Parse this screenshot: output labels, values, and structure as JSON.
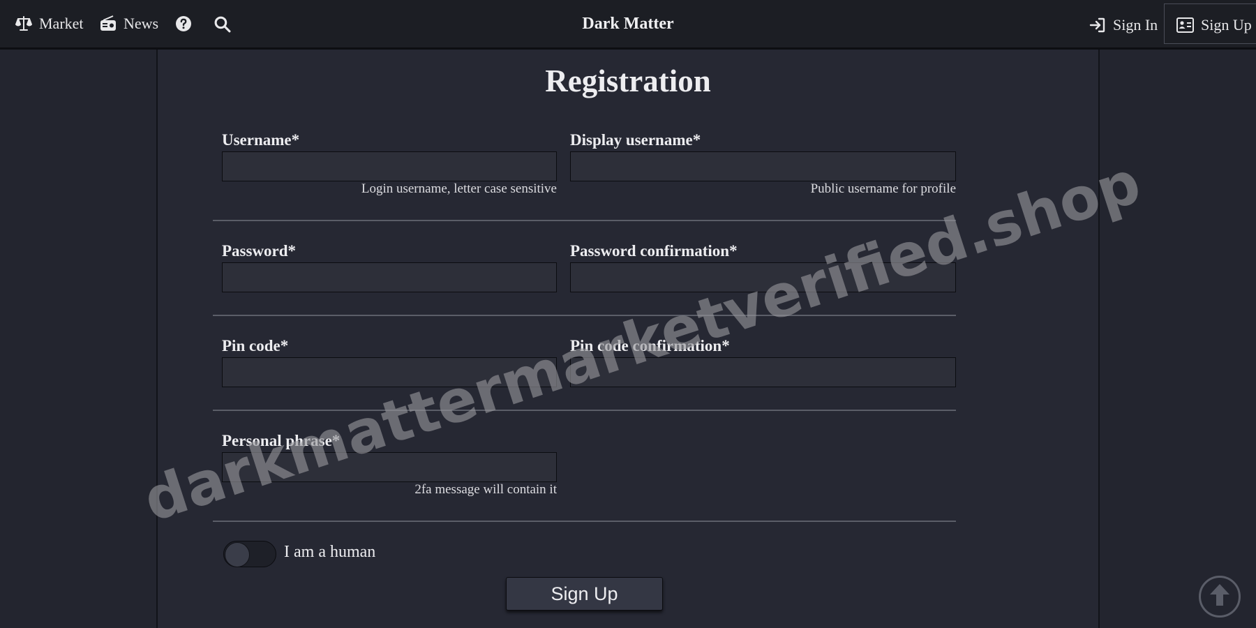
{
  "nav": {
    "market_label": "Market",
    "news_label": "News",
    "brand": "Dark Matter",
    "signin_label": "Sign In",
    "signup_label": "Sign Up"
  },
  "form": {
    "title": "Registration",
    "username": {
      "label": "Username*",
      "value": "",
      "help": "Login username, letter case sensitive"
    },
    "display_username": {
      "label": "Display username*",
      "value": "",
      "help": "Public username for profile"
    },
    "password": {
      "label": "Password*",
      "value": ""
    },
    "password_confirmation": {
      "label": "Password confirmation*",
      "value": ""
    },
    "pin": {
      "label": "Pin code*",
      "value": ""
    },
    "pin_confirmation": {
      "label": "Pin code confirmation*",
      "value": ""
    },
    "personal_phrase": {
      "label": "Personal phrase*",
      "value": "",
      "help": "2fa message will contain it"
    },
    "human_toggle": {
      "label": "I am a human",
      "checked": false
    },
    "submit_label": "Sign Up"
  },
  "watermark": "darkmattermarketverified.shop",
  "colors": {
    "background": "#23252f",
    "nav_background": "#1c1e24",
    "panel": "#262833",
    "input": "#2d2f39",
    "button": "#343744"
  },
  "icons": [
    "balance-scale-icon",
    "newspaper-radio-icon",
    "help-circle-icon",
    "search-icon",
    "sign-in-icon",
    "id-card-icon",
    "arrow-up-circle-icon"
  ]
}
